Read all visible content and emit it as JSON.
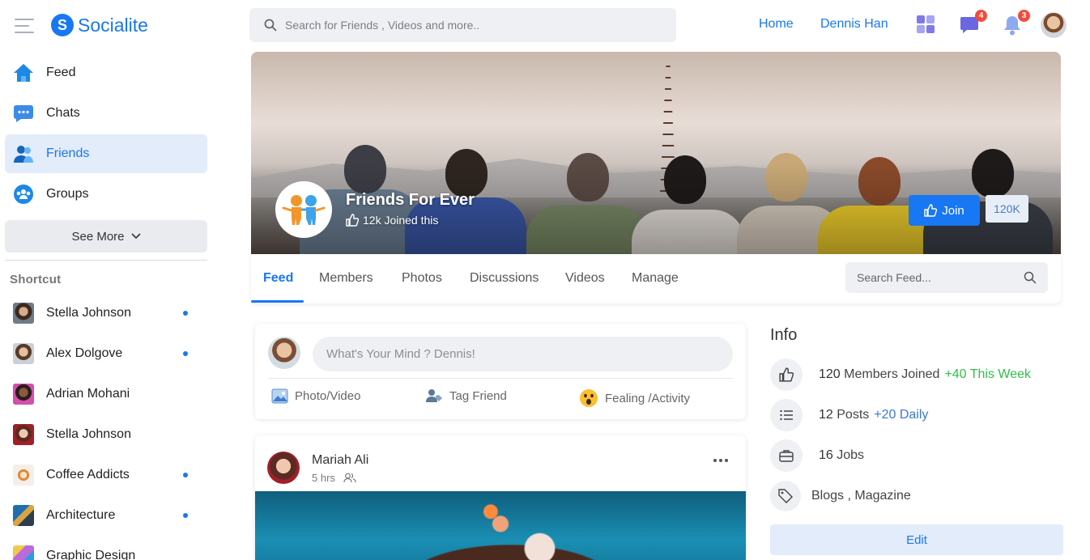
{
  "brand": {
    "name": "Socialite",
    "mark": "S",
    "color": "#1877f2"
  },
  "header": {
    "search_placeholder": "Search for Friends , Videos and more..",
    "nav": [
      "Home",
      "Dennis Han"
    ],
    "messages_badge": "4",
    "notifications_badge": "3"
  },
  "sidebar": {
    "items": [
      {
        "label": "Feed",
        "icon": "home-icon"
      },
      {
        "label": "Chats",
        "icon": "chat-icon"
      },
      {
        "label": "Friends",
        "icon": "friends-icon",
        "active": true
      },
      {
        "label": "Groups",
        "icon": "groups-icon"
      }
    ],
    "see_more": "See More",
    "shortcut_title": "Shortcut",
    "shortcuts": [
      {
        "label": "Stella Johnson",
        "online": true
      },
      {
        "label": "Alex Dolgove",
        "online": true
      },
      {
        "label": "Adrian Mohani",
        "online": false
      },
      {
        "label": "Stella Johnson",
        "online": false
      },
      {
        "label": "Coffee Addicts",
        "online": true
      },
      {
        "label": "Architecture",
        "online": true
      },
      {
        "label": "Graphic Design",
        "online": false
      }
    ]
  },
  "group": {
    "name": "Friends For Ever",
    "joined": "12k Joined this",
    "join_label": "Join",
    "join_count": "120K"
  },
  "tabs": [
    "Feed",
    "Members",
    "Photos",
    "Discussions",
    "Videos",
    "Manage"
  ],
  "active_tab": "Feed",
  "feed_search_placeholder": "Search Feed...",
  "composer": {
    "placeholder": "What's Your Mind ? Dennis!",
    "actions": [
      "Photo/Video",
      "Tag Friend",
      "Fealing /Activity"
    ]
  },
  "post": {
    "author": "Mariah Ali",
    "time": "5 hrs"
  },
  "info": {
    "title": "Info",
    "members": {
      "count": "120",
      "label": "Members Joined",
      "delta": "+40 This Week"
    },
    "posts": {
      "count": "12",
      "label": "Posts",
      "delta": "+20 Daily"
    },
    "jobs": {
      "count": "16",
      "label": "Jobs"
    },
    "tags": "Blogs , Magazine",
    "edit_label": "Edit"
  }
}
